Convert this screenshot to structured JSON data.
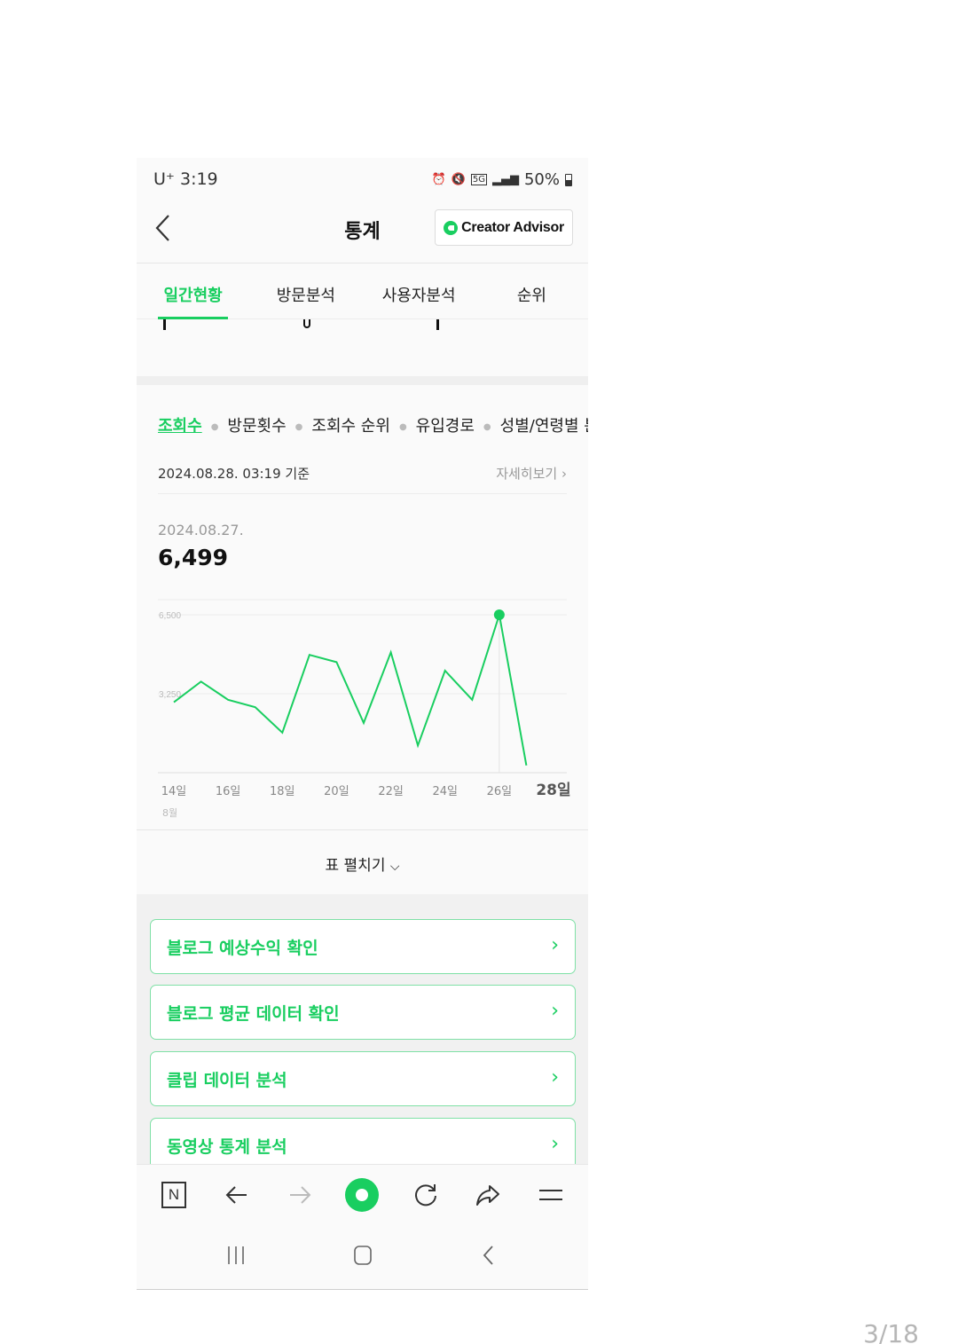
{
  "status_bar": {
    "carrier": "U⁺ 3:19",
    "network": "5G",
    "battery": "50%"
  },
  "header": {
    "title": "통계",
    "creator_advisor_label": "Creator Advisor"
  },
  "tabs": [
    {
      "label": "일간현황",
      "active": true
    },
    {
      "label": "방문분석",
      "active": false
    },
    {
      "label": "사용자분석",
      "active": false
    },
    {
      "label": "순위",
      "active": false
    }
  ],
  "sub_tabs": [
    {
      "label": "조회수",
      "active": true
    },
    {
      "label": "방문횟수",
      "active": false
    },
    {
      "label": "조회수 순위",
      "active": false
    },
    {
      "label": "유입경로",
      "active": false
    },
    {
      "label": "성별/연령별 분",
      "active": false
    }
  ],
  "basis_time": "2024.08.28. 03:19 기준",
  "detail_link": "자세히보기",
  "selected": {
    "date": "2024.08.27.",
    "value": "6,499"
  },
  "chart_data": {
    "type": "line",
    "x": [
      "14일",
      "15일",
      "16일",
      "17일",
      "18일",
      "19일",
      "20일",
      "21일",
      "22일",
      "23일",
      "24일",
      "25일",
      "26일",
      "27일",
      "28일"
    ],
    "values": [
      2900,
      3750,
      3000,
      2700,
      1650,
      4850,
      4550,
      2050,
      4950,
      1120,
      4200,
      3000,
      6499,
      300
    ],
    "tick_labels": [
      "14일",
      "16일",
      "18일",
      "20일",
      "22일",
      "24일",
      "26일",
      "28일"
    ],
    "month_label": "8월",
    "y_ticks": [
      6500,
      3250
    ],
    "y_tick_labels": [
      "6,500",
      "3,250"
    ],
    "ylim": [
      0,
      6500
    ],
    "highlight_date": "27일",
    "line_color": "#19ce60",
    "note": "series ends at 28일 partial-day"
  },
  "table_toggle": "표 펼치기",
  "cards": [
    {
      "label": "블로그 예상수익 확인"
    },
    {
      "label": "블로그 평균 데이터 확인"
    },
    {
      "label": "클립 데이터 분석"
    },
    {
      "label": "동영상 통계 분석"
    }
  ],
  "toolbar": {
    "naver_label": "N",
    "icons": [
      "naver-home-icon",
      "back-arrow-icon",
      "forward-arrow-icon",
      "green-dot-icon",
      "refresh-icon",
      "share-icon",
      "menu-icon"
    ]
  },
  "page_indicator": "3/18",
  "colors": {
    "accent": "#19ce60",
    "card_border": "#7fe0a6"
  }
}
